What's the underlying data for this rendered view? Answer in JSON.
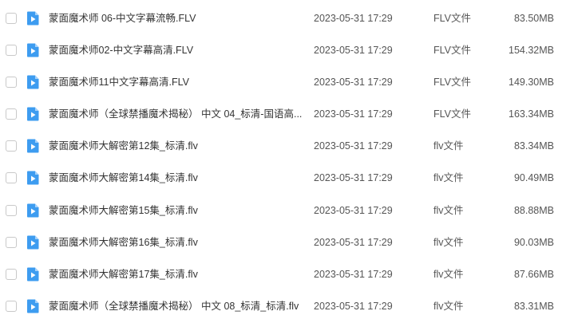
{
  "files": [
    {
      "name": "蒙面魔术师 06-中文字幕流畅.FLV",
      "date": "2023-05-31 17:29",
      "type": "FLV文件",
      "size": "83.50MB",
      "icon": "video-file-icon"
    },
    {
      "name": "蒙面魔术师02-中文字幕高清.FLV",
      "date": "2023-05-31 17:29",
      "type": "FLV文件",
      "size": "154.32MB",
      "icon": "video-file-icon"
    },
    {
      "name": "蒙面魔术师11中文字幕高清.FLV",
      "date": "2023-05-31 17:29",
      "type": "FLV文件",
      "size": "149.30MB",
      "icon": "video-file-icon"
    },
    {
      "name": "蒙面魔术师（全球禁播魔术揭秘） 中文 04_标清-国语高...",
      "date": "2023-05-31 17:29",
      "type": "FLV文件",
      "size": "163.34MB",
      "icon": "video-file-icon"
    },
    {
      "name": "蒙面魔术师大解密第12集_标清.flv",
      "date": "2023-05-31 17:29",
      "type": "flv文件",
      "size": "83.34MB",
      "icon": "video-file-icon"
    },
    {
      "name": "蒙面魔术师大解密第14集_标清.flv",
      "date": "2023-05-31 17:29",
      "type": "flv文件",
      "size": "90.49MB",
      "icon": "video-file-icon"
    },
    {
      "name": "蒙面魔术师大解密第15集_标清.flv",
      "date": "2023-05-31 17:29",
      "type": "flv文件",
      "size": "88.88MB",
      "icon": "video-file-icon"
    },
    {
      "name": "蒙面魔术师大解密第16集_标清.flv",
      "date": "2023-05-31 17:29",
      "type": "flv文件",
      "size": "90.03MB",
      "icon": "video-file-icon"
    },
    {
      "name": "蒙面魔术师大解密第17集_标清.flv",
      "date": "2023-05-31 17:29",
      "type": "flv文件",
      "size": "87.66MB",
      "icon": "video-file-icon"
    },
    {
      "name": "蒙面魔术师（全球禁播魔术揭秘） 中文 08_标清_标清.flv",
      "date": "2023-05-31 17:29",
      "type": "flv文件",
      "size": "83.31MB",
      "icon": "video-file-icon"
    }
  ],
  "colors": {
    "icon_blue": "#3d9cf0",
    "icon_fold": "#a6d2fa",
    "text": "#333333",
    "muted": "#555555",
    "checkbox_border": "#c9c9c9"
  }
}
